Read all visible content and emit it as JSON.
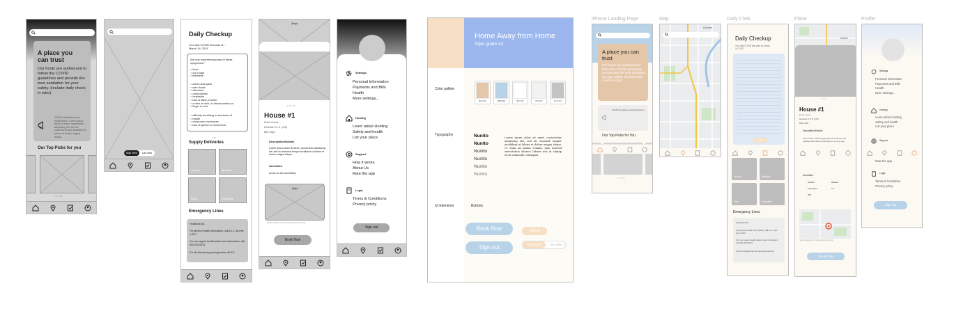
{
  "wireframes": {
    "landing": {
      "headline": "A place you can trust",
      "body": "Our hosts are authorized to follow the COVID guidelines and provide the best sanitation for your safety. (include daily check in intro)",
      "announce": "COVID Guidelines and Restrictions. Lorem ipsum dolor sit amet, consectetur adipiscing elit, sed do eiusmod tempor incididunt ut labore et dolore magna aliqua.",
      "picks_title": "Our Top Picks for you",
      "dots": "• • • • •"
    },
    "map": {
      "toggle_map": "Map View",
      "toggle_list": "List View"
    },
    "checkup": {
      "title": "Daily Checkup",
      "subtitle": "Your last COVID test was on March 14, 2021",
      "question": "Are you experiencing any of these symptoms?",
      "symptoms_a": [
        "fever",
        "dry cough",
        "tiredness"
      ],
      "symptoms_b": [
        "aches and pains",
        "sore throat",
        "diarrhoea",
        "conjunctivitis",
        "headache",
        "loss of taste or smell",
        "a rash on skin, or discolouration on",
        "finger or toes"
      ],
      "symptoms_c": [
        "difficulty breathing or shortness of",
        "breath",
        "chest pain or pressure",
        "loss of speech or movement"
      ],
      "supply_title": "Supply Deliveries",
      "supply_items": [
        "Grocery",
        "Medicine",
        "Food",
        "Essentials"
      ],
      "emergency_title": "Emergency Lines",
      "emergency_1": "Healthlink BC",
      "emergency_2": "For general health information, call 8-1-1 toll-free in B.C.",
      "emergency_3": "For non-urgent health advice and information, call 604-215-8110.",
      "emergency_4": "For life-threatening emergencies call 911."
    },
    "place": {
      "map_label": "(Map)",
      "dots": "• • • • •",
      "title": "House #1",
      "type": "Entire House",
      "reviews": "Reviews 3.9 ★ (478)",
      "price": "$95 /night",
      "desc_title": "Description/Details",
      "desc": "Lorem ipsum dolor sit amet, consectetur adipiscing elit, sed do eiusmod tempor incididunt ut labore et dolore magna aliqua.",
      "amenities_title": "Amenities",
      "amenities": "(Icons for the amenities)",
      "map2_label": "(Map)",
      "exact": "Exact location will be provided upon booking",
      "book": "Book Now"
    },
    "profile": {
      "settings_title": "Settings",
      "settings": [
        "Personal Information",
        "Payments and Bills",
        "Health",
        "More settings..."
      ],
      "hosting_title": "Hosting",
      "hosting": [
        "Learn about Hosting",
        "Safety and health",
        "List your place"
      ],
      "support_title": "Support",
      "support": [
        "How it works",
        "About Us",
        "Rate the app"
      ],
      "legal_title": "Legal",
      "legal": [
        "Terms & Conditions",
        "Privacy policy"
      ],
      "signout": "Sign out"
    }
  },
  "styleguide": {
    "title": "Home Away from Home",
    "subtitle": "Style guide #3",
    "palette_label": "Color pallete",
    "palette": [
      {
        "hex": "#E4C6A9",
        "label": "#E4C6A9"
      },
      {
        "hex": "#B8D3E8",
        "label": "#B8D3E8"
      },
      {
        "hex": "#FFFFFF",
        "label": "#FFFFFF"
      },
      {
        "hex": "#F2F2F2",
        "label": "#F2F2F2"
      },
      {
        "hex": "#C4C4C4",
        "label": "#C4C4C4"
      }
    ],
    "typography_label": "Typography",
    "fonts": [
      "Nunito",
      "Nunito",
      "Nunito",
      "Nunito",
      "Nunito",
      "Nunito"
    ],
    "lorem": "Lorem ipsum dolor sit amet, consectetur adipiscing elit, sed do eiusmod tempor incididunt ut labore et dolore magna aliqua. Ut enim ad minim veniam, quis nostrud exercitation ullamco laboris nisi ut aliquip ex ea commodo consequat.",
    "ui_label": "UI Elements",
    "buttons_label": "Buttons",
    "btn_book": "Book Now",
    "btn_signout": "Sign out",
    "btn_submit": "Submit",
    "toggle_map": "Map View",
    "toggle_list": "List View"
  },
  "hifi": {
    "labels": [
      "iPhone Landing Page",
      "Map",
      "Daily Chek",
      "Place",
      "Profile"
    ],
    "landing": {
      "headline": "A place you can trust",
      "body": "Our hosts are authorized to follow the COVID guidelines and provide the best sanitation for your safety. (include daily check in intro)",
      "announce": "COVID Guidelines and Restrictions",
      "picks": "Our Top Picks for You"
    },
    "map": {
      "area": "Garden"
    },
    "checkup": {
      "title": "Daily Checkup",
      "subtitle": "Your last COVID test was on March 14, 2021",
      "submit": "Submit",
      "supply": [
        "Grocery",
        "Medicine",
        "Food",
        "Essentials"
      ],
      "emergency_title": "Emergency Lines",
      "emergency_1": "Healthlink BC",
      "emergency_2": "For general health information, call 8-1-1 toll-free in B.C.",
      "emergency_3": "For non-urgent health advice and information, call 604-215-8110.",
      "emergency_4": "For life-threatening emergencies call 911."
    },
    "place": {
      "area": "Garden",
      "title": "House #1",
      "type": "Entire House",
      "reviews": "Reviews 3.9 ★ (478)",
      "price": "$95 /night",
      "desc_title": "Description/Details",
      "desc": "This modern charming garden level house was updated with all the amenities for a cozy stay...",
      "amenities_title": "Amenities",
      "amenities": [
        "Kitchen",
        "Washer",
        "Free dryer",
        "TV",
        "Wifi"
      ],
      "exact": "Exact location will be provided upon booking",
      "book": "Book Now"
    },
    "profile": {
      "settings_title": "Settings",
      "settings": [
        "Personal Information",
        "Payments and Bills",
        "Health",
        "More settings..."
      ],
      "hosting_title": "Hosting",
      "hosting": [
        "Learn about Hosting",
        "Safety and health",
        "List your place"
      ],
      "support_title": "Support",
      "support": [
        "Rate the app"
      ],
      "legal_title": "Legal",
      "legal": [
        "Terms & Conditions",
        "Privacy policy"
      ],
      "signout": "Sign out"
    }
  },
  "colors": {
    "blue": "#9BB7EE",
    "peach": "#E4C6A9",
    "lightblue": "#B8D3E8",
    "orange": "#E9A27A",
    "grey": "#C4C4C4"
  }
}
